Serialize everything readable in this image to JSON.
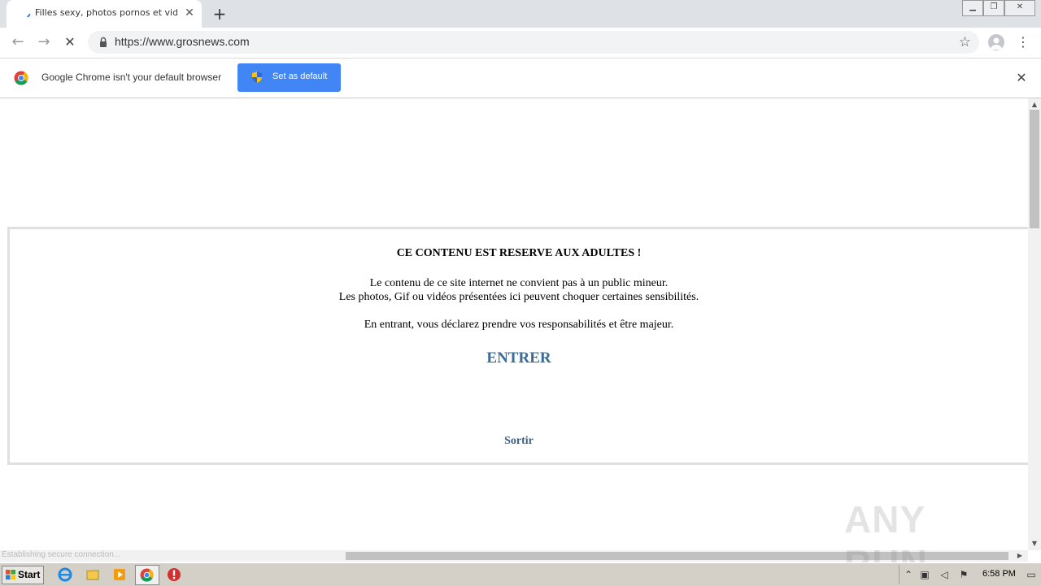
{
  "browser": {
    "tab": {
      "title": "Filles sexy, photos pornos et vidéos"
    },
    "address_bar": {
      "url": "https://www.grosnews.com"
    },
    "infobar": {
      "message": "Google Chrome isn't your default browser",
      "button_label": "Set as default"
    },
    "status_text": "Establishing secure connection..."
  },
  "page": {
    "heading": "CE CONTENU EST RESERVE AUX ADULTES !",
    "line1": "Le contenu de ce site internet ne convient pas à un public mineur.",
    "line2": "Les photos, Gif ou vidéos présentées ici peuvent choquer certaines sensibilités.",
    "line3": "En entrant, vous déclarez prendre vos responsabilités et être majeur.",
    "enter_label": "ENTRER",
    "exit_label": "Sortir"
  },
  "taskbar": {
    "start_label": "Start",
    "clock": "6:58 PM"
  },
  "watermark": "ANY RUN",
  "colors": {
    "accent": "#4285f4",
    "link_enter": "#3a6a96",
    "link_exit": "#3a5f87"
  }
}
